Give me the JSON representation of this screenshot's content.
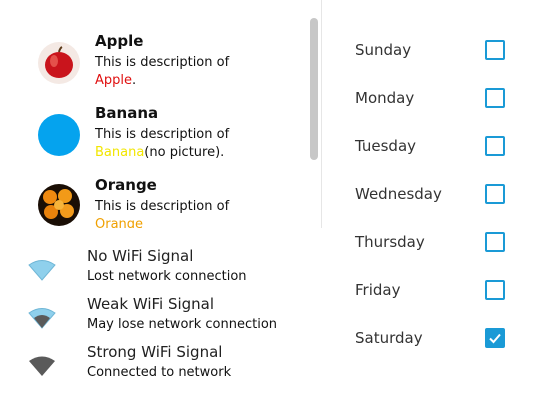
{
  "fruits": [
    {
      "name": "Apple",
      "desc_prefix": "This is description of",
      "highlight": "Apple",
      "suffix": ".",
      "highlight_color": "#e01010",
      "picture": "apple"
    },
    {
      "name": "Banana",
      "desc_prefix": "This is description of",
      "highlight": "Banana",
      "suffix": "(no picture).",
      "highlight_color": "#f2e600",
      "picture": "none"
    },
    {
      "name": "Orange",
      "desc_prefix": "This is description of",
      "highlight": "Orange",
      "suffix": "",
      "highlight_color": "#f0a000",
      "picture": "orange"
    }
  ],
  "wifi": [
    {
      "title": "No WiFi Signal",
      "subtitle": "Lost network connection",
      "icon": "wifi-none-icon"
    },
    {
      "title": "Weak WiFi Signal",
      "subtitle": "May lose network connection",
      "icon": "wifi-weak-icon"
    },
    {
      "title": "Strong WiFi Signal",
      "subtitle": "Connected to network",
      "icon": "wifi-strong-icon"
    }
  ],
  "days": [
    {
      "label": "Sunday",
      "checked": false
    },
    {
      "label": "Monday",
      "checked": false
    },
    {
      "label": "Tuesday",
      "checked": false
    },
    {
      "label": "Wednesday",
      "checked": false
    },
    {
      "label": "Thursday",
      "checked": false
    },
    {
      "label": "Friday",
      "checked": false
    },
    {
      "label": "Saturday",
      "checked": true
    }
  ],
  "colors": {
    "accent": "#1a9ad6",
    "banana_circle": "#05a3ee",
    "wifi_icon": "#5a5a5a",
    "wifi_icon_light": "#8fd0ec"
  }
}
